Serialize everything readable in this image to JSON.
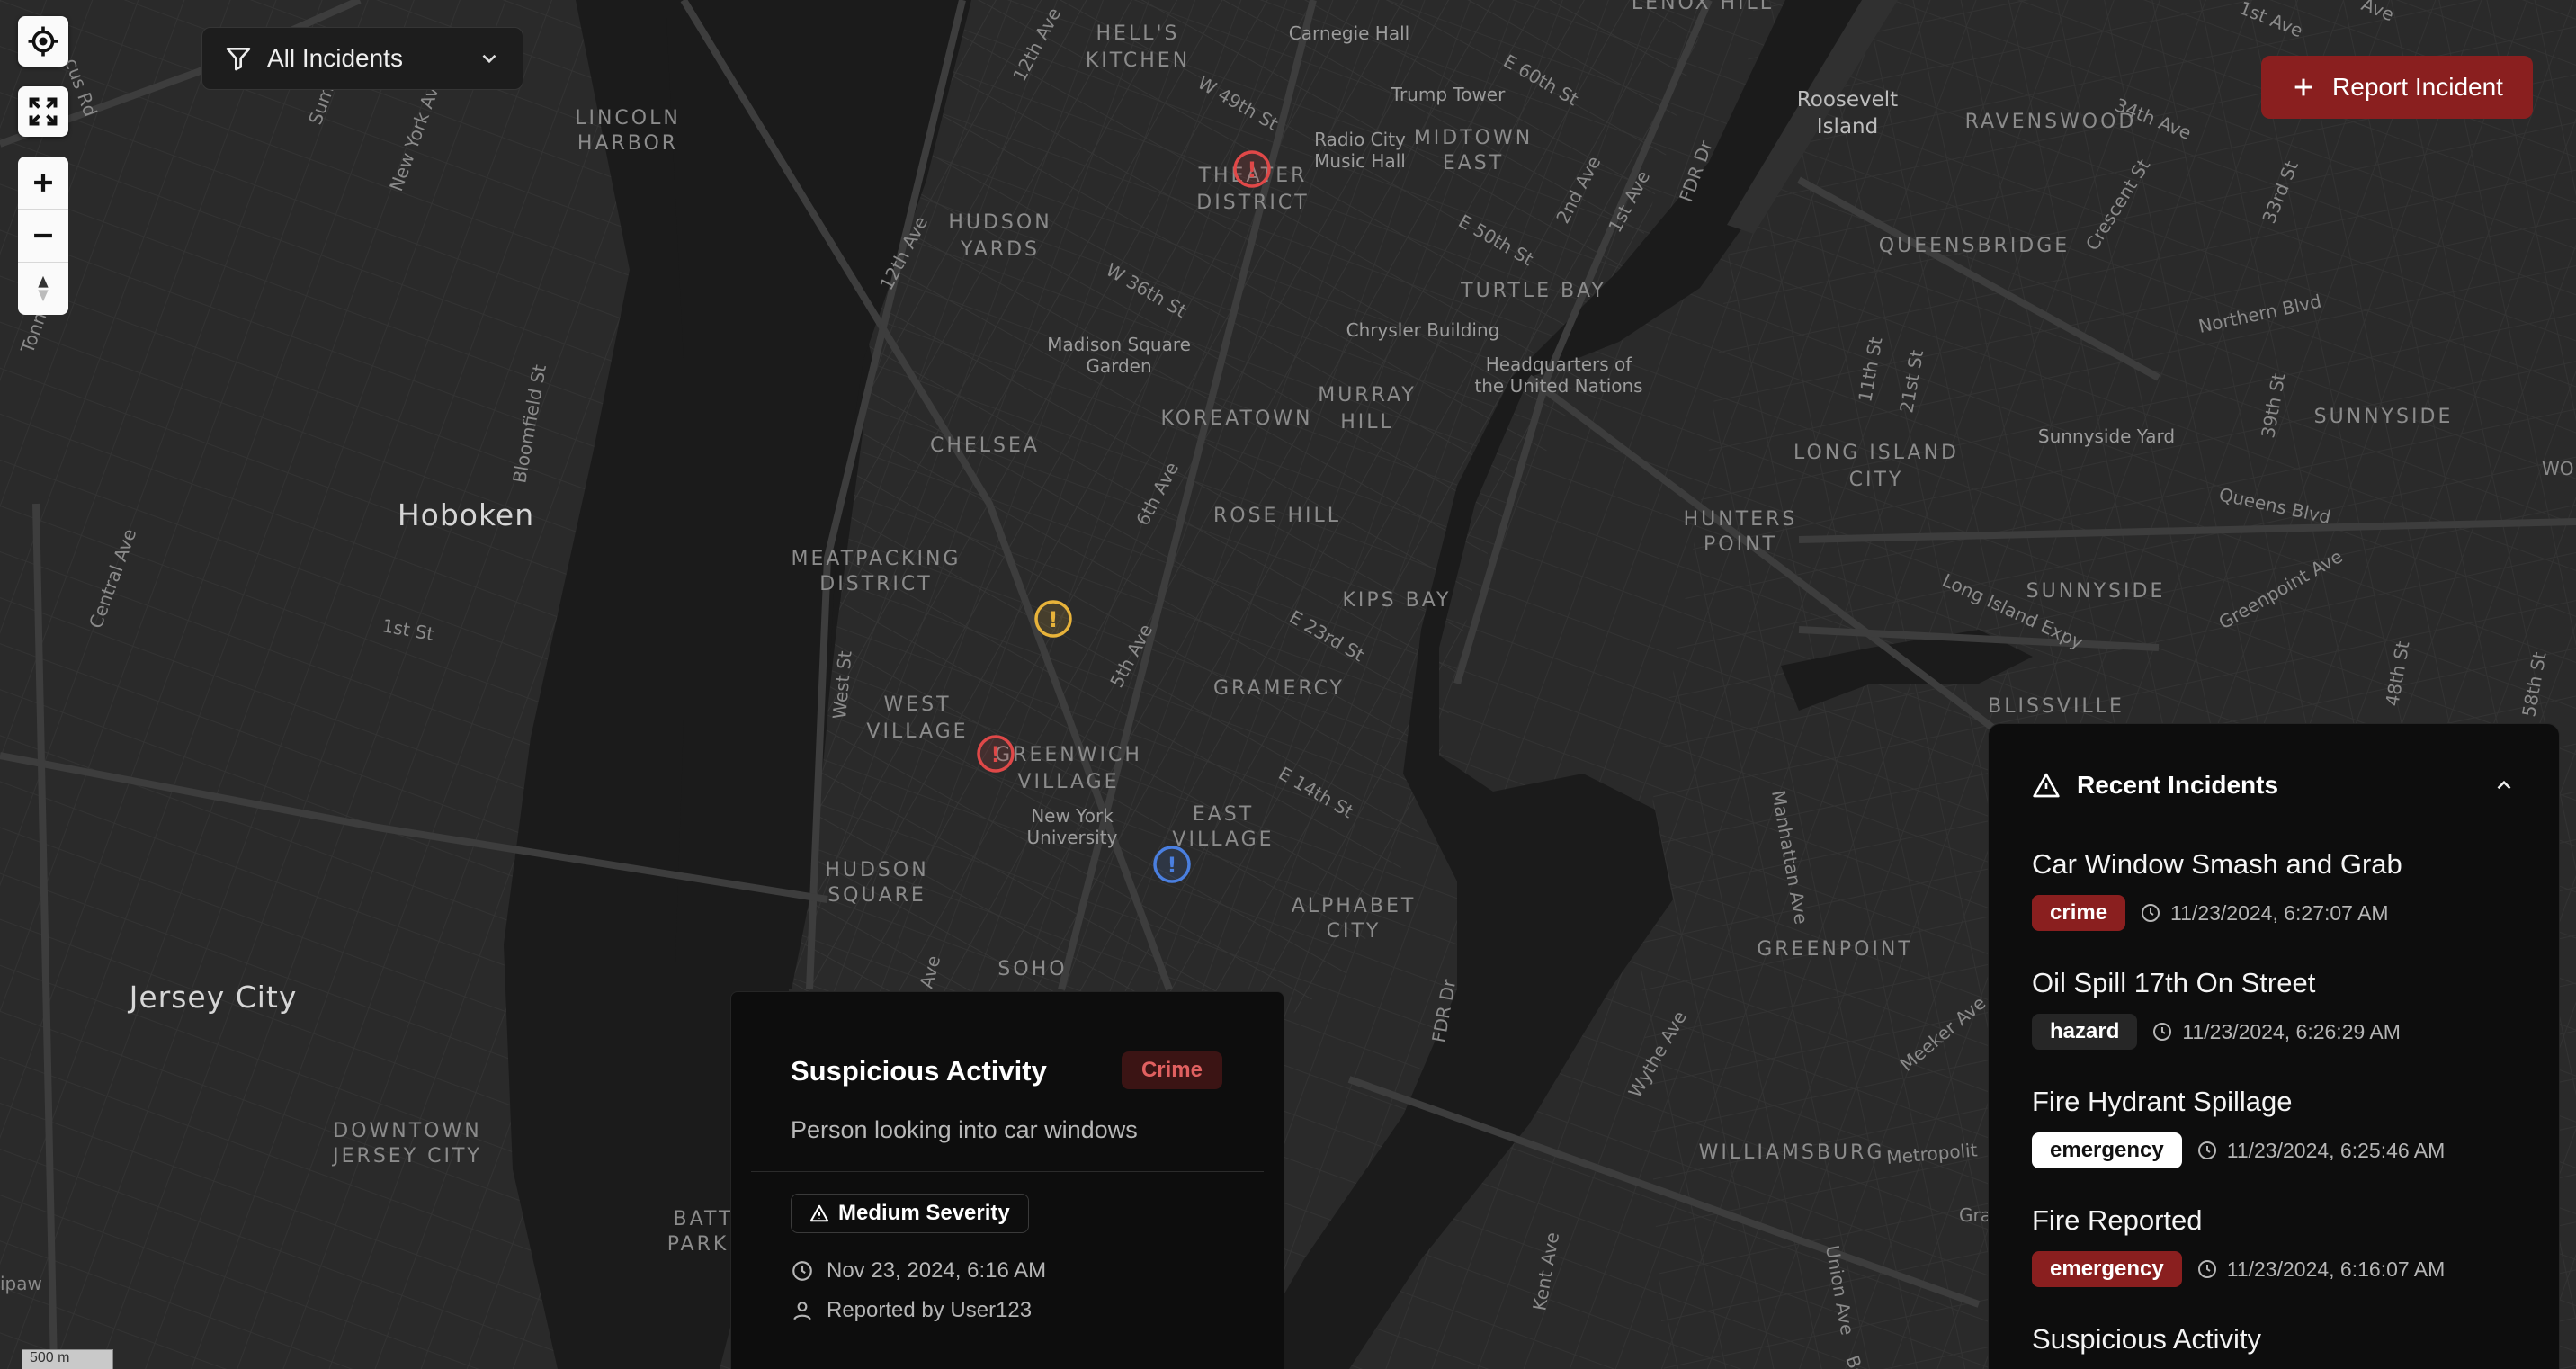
{
  "map": {
    "labels": {
      "hells_kitchen": [
        "HELL'S",
        "KITCHEN"
      ],
      "lincoln_harbor": [
        "LINCOLN",
        "HARBOR"
      ],
      "hudson_yards": [
        "HUDSON",
        "YARDS"
      ],
      "theater_district": [
        "THEATER",
        "DISTRICT"
      ],
      "midtown_east": [
        "MIDTOWN",
        "EAST"
      ],
      "turtle_bay": "TURTLE BAY",
      "koreatown": "KOREATOWN",
      "murray_hill": [
        "MURRAY",
        "HILL"
      ],
      "chelsea": "CHELSEA",
      "rose_hill": "ROSE HILL",
      "meatpacking": [
        "MEATPACKING",
        "DISTRICT"
      ],
      "kips_bay": "KIPS BAY",
      "gramercy": "GRAMERCY",
      "west_village": [
        "WEST",
        "VILLAGE"
      ],
      "greenwich_village": [
        "GREENWICH",
        "VILLAGE"
      ],
      "east_village": [
        "EAST",
        "VILLAGE"
      ],
      "hudson_square": [
        "HUDSON",
        "SQUARE"
      ],
      "alphabet_city": [
        "ALPHABET",
        "CITY"
      ],
      "soho": "SOHO",
      "hoboken": "Hoboken",
      "jersey_city": "Jersey City",
      "downtown_jersey_city": [
        "DOWNTOWN",
        "JERSEY CITY"
      ],
      "battery_park": [
        "BATT",
        "PARK"
      ],
      "roosevelt_island": [
        "Roosevelt",
        "Island"
      ],
      "ravenswood": "RAVENSWOOD",
      "queensbridge": "QUEENSBRIDGE",
      "long_island_city": [
        "LONG ISLAND",
        "CITY"
      ],
      "hunters_point": [
        "HUNTERS",
        "POINT"
      ],
      "sunnyside": "SUNNYSIDE",
      "sunnyside_2": "SUNNYSIDE",
      "blissville": "BLISSVILLE",
      "greenpoint": "GREENPOINT",
      "williamsburg": "WILLIAMSBURG",
      "lenox_hill": "LENOX HILL",
      "carnegie_hall": "Carnegie Hall",
      "trump_tower": "Trump Tower",
      "radio_city": [
        "Radio City",
        "Music Hall"
      ],
      "madison_square_garden": [
        "Madison Square",
        "Garden"
      ],
      "chrysler_building": "Chrysler Building",
      "un_hq": [
        "Headquarters of",
        "the United Nations"
      ],
      "nyu": [
        "New York",
        "University"
      ],
      "sunnyside_yard": "Sunnyside Yard"
    },
    "streets": {
      "sum": "Sum",
      "new_york_ave": "New York Ave",
      "tonnelle_ave": "Tonne",
      "bloomfield_st": "Bloomfield St",
      "central_ave": "Central Ave",
      "first_st_hoboken": "1st St",
      "twelfth_ave_n": "12th Ave",
      "twelfth_ave": "12th Ave",
      "w49": "W 49th St",
      "w36": "W 36th St",
      "e60": "E 60th St",
      "e50": "E 50th St",
      "second_ave": "2nd Ave",
      "first_ave": "1st Ave",
      "fdr_dr_n": "FDR Dr",
      "sixth_ave": "6th Ave",
      "fifth_ave": "5th Ave",
      "e23": "E 23rd St",
      "e14": "E 14th St",
      "west_st": "West St",
      "fdr_dr_s": "FDR Dr",
      "ave_soho": "Ave",
      "thirtyfourth_ave": "34th Ave",
      "crescent_st": "Crescent St",
      "thirtythird_st": "33rd St",
      "northern_blvd": "Northern Blvd",
      "eleventh_st": "11th St",
      "twentyfirst_st": "21st St",
      "thirtyninth_st": "39th St",
      "queens_blvd": "Queens Blvd",
      "long_island_expy": "Long Island Expy",
      "greenpoint_ave": "Greenpoint Ave",
      "fortyeighth_st": "48th St",
      "fiftyeighth_st": "58th St",
      "manhattan_ave": "Manhattan Ave",
      "meeker_ave": "Meeker Ave",
      "wythe_ave": "Wythe Ave",
      "metropolitan": "Metropolit",
      "kent_ave": "Kent Ave",
      "union_ave": "Union Ave",
      "grand": "Gra",
      "first_st_ave": "1st Ave",
      "cus_rd": "cus Rd",
      "ipaw": "ipaw",
      "wo": "WO",
      "ave_top": "Ave",
      "st_top": "St",
      "be": "Be"
    },
    "markers": [
      {
        "name": "theater-district",
        "color": "#e04848"
      },
      {
        "name": "chelsea",
        "color": "#e8b33a"
      },
      {
        "name": "greenwich-village",
        "color": "#e04848"
      },
      {
        "name": "east-village",
        "color": "#4a7fe0"
      }
    ],
    "scale_label": "500 m"
  },
  "filter": {
    "label": "All Incidents",
    "icon": "filter-icon"
  },
  "report_button": {
    "label": "Report Incident",
    "icon": "plus-icon"
  },
  "popup": {
    "title": "Suspicious Activity",
    "category": "Crime",
    "description": "Person looking into car windows",
    "severity": "Medium Severity",
    "datetime": "Nov 23, 2024, 6:16 AM",
    "reporter": "Reported by User123"
  },
  "recent": {
    "title": "Recent Incidents",
    "items": [
      {
        "title": "Car Window Smash and Grab",
        "type": "crime",
        "time": "11/23/2024, 6:27:07 AM"
      },
      {
        "title": "Oil Spill 17th On Street",
        "type": "hazard",
        "time": "11/23/2024, 6:26:29 AM"
      },
      {
        "title": "Fire Hydrant Spillage",
        "type": "emergency",
        "time": "11/23/2024, 6:25:46 AM"
      },
      {
        "title": "Fire Reported",
        "type": "emergency",
        "time": "11/23/2024, 6:16:07 AM"
      },
      {
        "title": "Suspicious Activity",
        "type": "",
        "time": ""
      }
    ]
  },
  "colors": {
    "accent_red": "#8a1f1f",
    "marker_red": "#e04848",
    "marker_yellow": "#e8b33a",
    "marker_blue": "#4a7fe0"
  }
}
